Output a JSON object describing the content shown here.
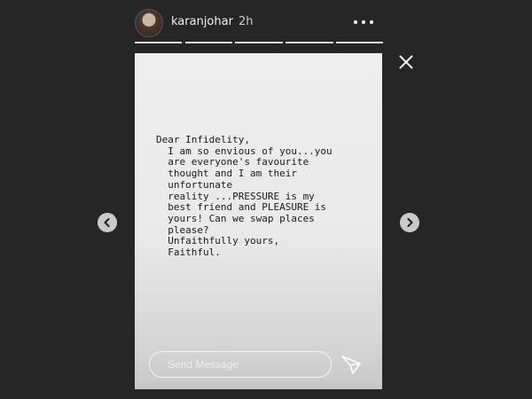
{
  "header": {
    "username": "karanjohar",
    "timestamp": "2h",
    "more_icon": "more-horizontal-icon",
    "avatar_icon": "profile-avatar"
  },
  "progress": {
    "segments": 5,
    "active_segment": 1
  },
  "story": {
    "text": "Dear Infidelity,\n  I am so envious of you...you\n  are everyone's favourite\n  thought and I am their\n  unfortunate\n  reality ...PRESSURE is my\n  best friend and PLEASURE is\n  yours! Can we swap places\n  please?\n  Unfaithfully yours,\n  Faithful."
  },
  "controls": {
    "close_icon": "close-icon",
    "prev_icon": "chevron-left-icon",
    "next_icon": "chevron-right-icon",
    "send_icon": "send-icon"
  },
  "reply": {
    "placeholder": "Send Message"
  },
  "colors": {
    "background": "#262626",
    "card": "#ececec",
    "text": "#1a1a1a"
  }
}
